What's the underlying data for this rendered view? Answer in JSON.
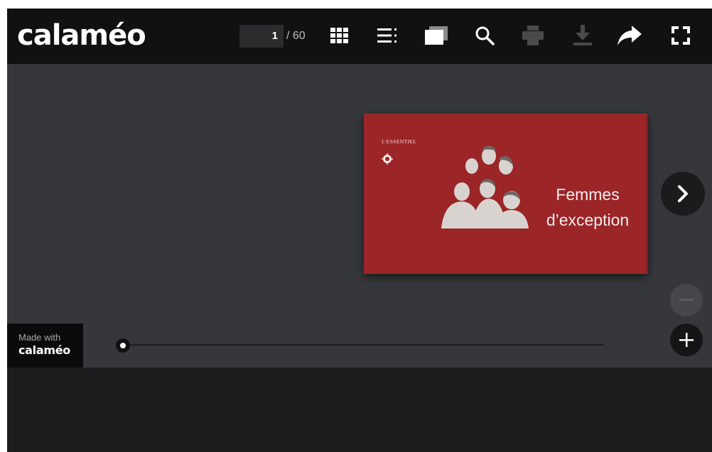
{
  "app": {
    "logo_text": "calaméo"
  },
  "toolbar": {
    "page_current": "1",
    "page_total": "/ 60",
    "icons": [
      "thumbnails-icon",
      "table-of-contents-icon",
      "library-icon",
      "search-icon",
      "print-icon",
      "download-icon",
      "share-icon",
      "fullscreen-icon"
    ],
    "disabled": [
      "print-icon",
      "download-icon"
    ]
  },
  "publication": {
    "brand": "L'ESSENTIEL",
    "title_line1": "Femmes",
    "title_line2": "d’exception",
    "cover_color": "#9b2527"
  },
  "footer": {
    "made_with_label": "Made with",
    "made_with_logo": "calaméo"
  },
  "navigation": {
    "slider_position": 0,
    "zoom_out_enabled": false,
    "zoom_in_enabled": true
  },
  "colors": {
    "toolbar_bg": "#111111",
    "viewer_bg": "#35373a",
    "icon_active": "#ffffff",
    "icon_disabled": "#4a4a4a"
  }
}
